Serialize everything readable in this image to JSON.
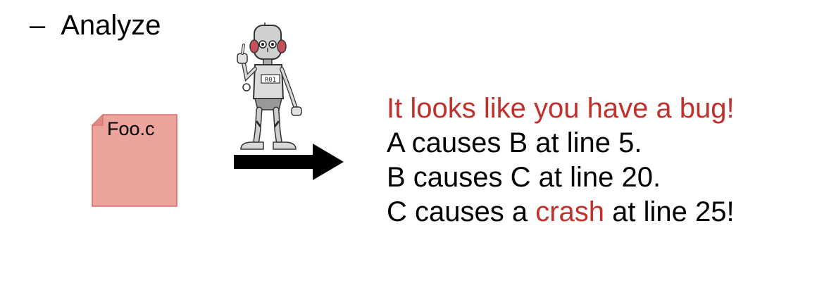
{
  "bullet": {
    "dash": "–",
    "text": "Analyze"
  },
  "file": {
    "name": "Foo.c",
    "fill_color": "#eca39c",
    "border_color": "#d46a64"
  },
  "robot": {
    "chest_badge": "R01",
    "icon": "robot-pointing-icon"
  },
  "arrow": {
    "icon": "right-arrow-icon"
  },
  "message": {
    "headline": "It looks like you have a bug!",
    "line1": "A causes B at line 5.",
    "line2": "B causes C at line 20.",
    "line3_pre": "C causes a ",
    "line3_highlight": "crash",
    "line3_post": " at line 25!",
    "highlight_color": "#c0302c"
  }
}
